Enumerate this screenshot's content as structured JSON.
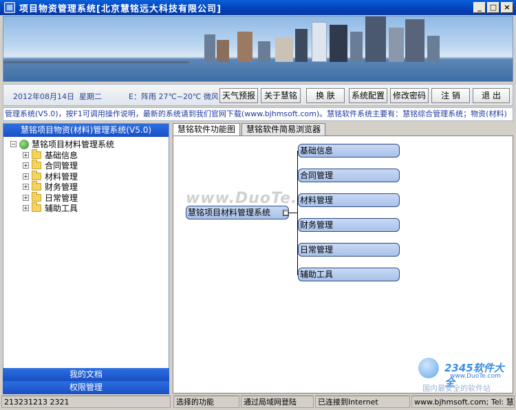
{
  "window": {
    "title": "项目物资管理系统[北京慧铭远大科技有限公司]",
    "controls": {
      "minimize": "_",
      "maximize": "□",
      "close": "×"
    }
  },
  "toolbar": {
    "date": "2012年08月14日",
    "weekday": "星期二",
    "weather": "E：阵雨   27℃~20℃  微风",
    "buttons": [
      "天气预报",
      "关于慧铭",
      "换 肤",
      "系统配置",
      "修改密码",
      "注 销",
      "退 出"
    ]
  },
  "marquee": {
    "text": "管理系统(V5.0)，按F1可调用操作说明，最新的系统请到我们官网下载(www.bjhmsoft.com)。慧铭软件系统主要有：慧铭综合管理系统；物资(材料)"
  },
  "left_panel": {
    "header": "慧铭项目物资(材料)管理系统(V5.0)",
    "tree": {
      "root": "慧铭项目材料管理系统",
      "children": [
        "基础信息",
        "合同管理",
        "材料管理",
        "财务管理",
        "日常管理",
        "辅助工具"
      ]
    },
    "footer_buttons": [
      "我的文档",
      "权限管理"
    ]
  },
  "right_panel": {
    "tabs": [
      "慧铭软件功能图",
      "慧铭软件简易浏览器"
    ],
    "diagram": {
      "root": "慧铭项目材料管理系统",
      "branches": [
        "基础信息",
        "合同管理",
        "材料管理",
        "财务管理",
        "日常管理",
        "辅助工具"
      ],
      "collapse_symbol": "□"
    },
    "watermark": "www.DuoTe.com"
  },
  "statusbar": {
    "cells": [
      "213231213 2321",
      "选择的功能",
      "通过局域网登陆",
      "已连接到Internet",
      "www.bjhmsoft.com; Tel: 慧"
    ]
  },
  "logo": {
    "brand": "2345软件大全",
    "url": "www.DuoTe.com",
    "slogan": "国内最安全的软件站"
  }
}
